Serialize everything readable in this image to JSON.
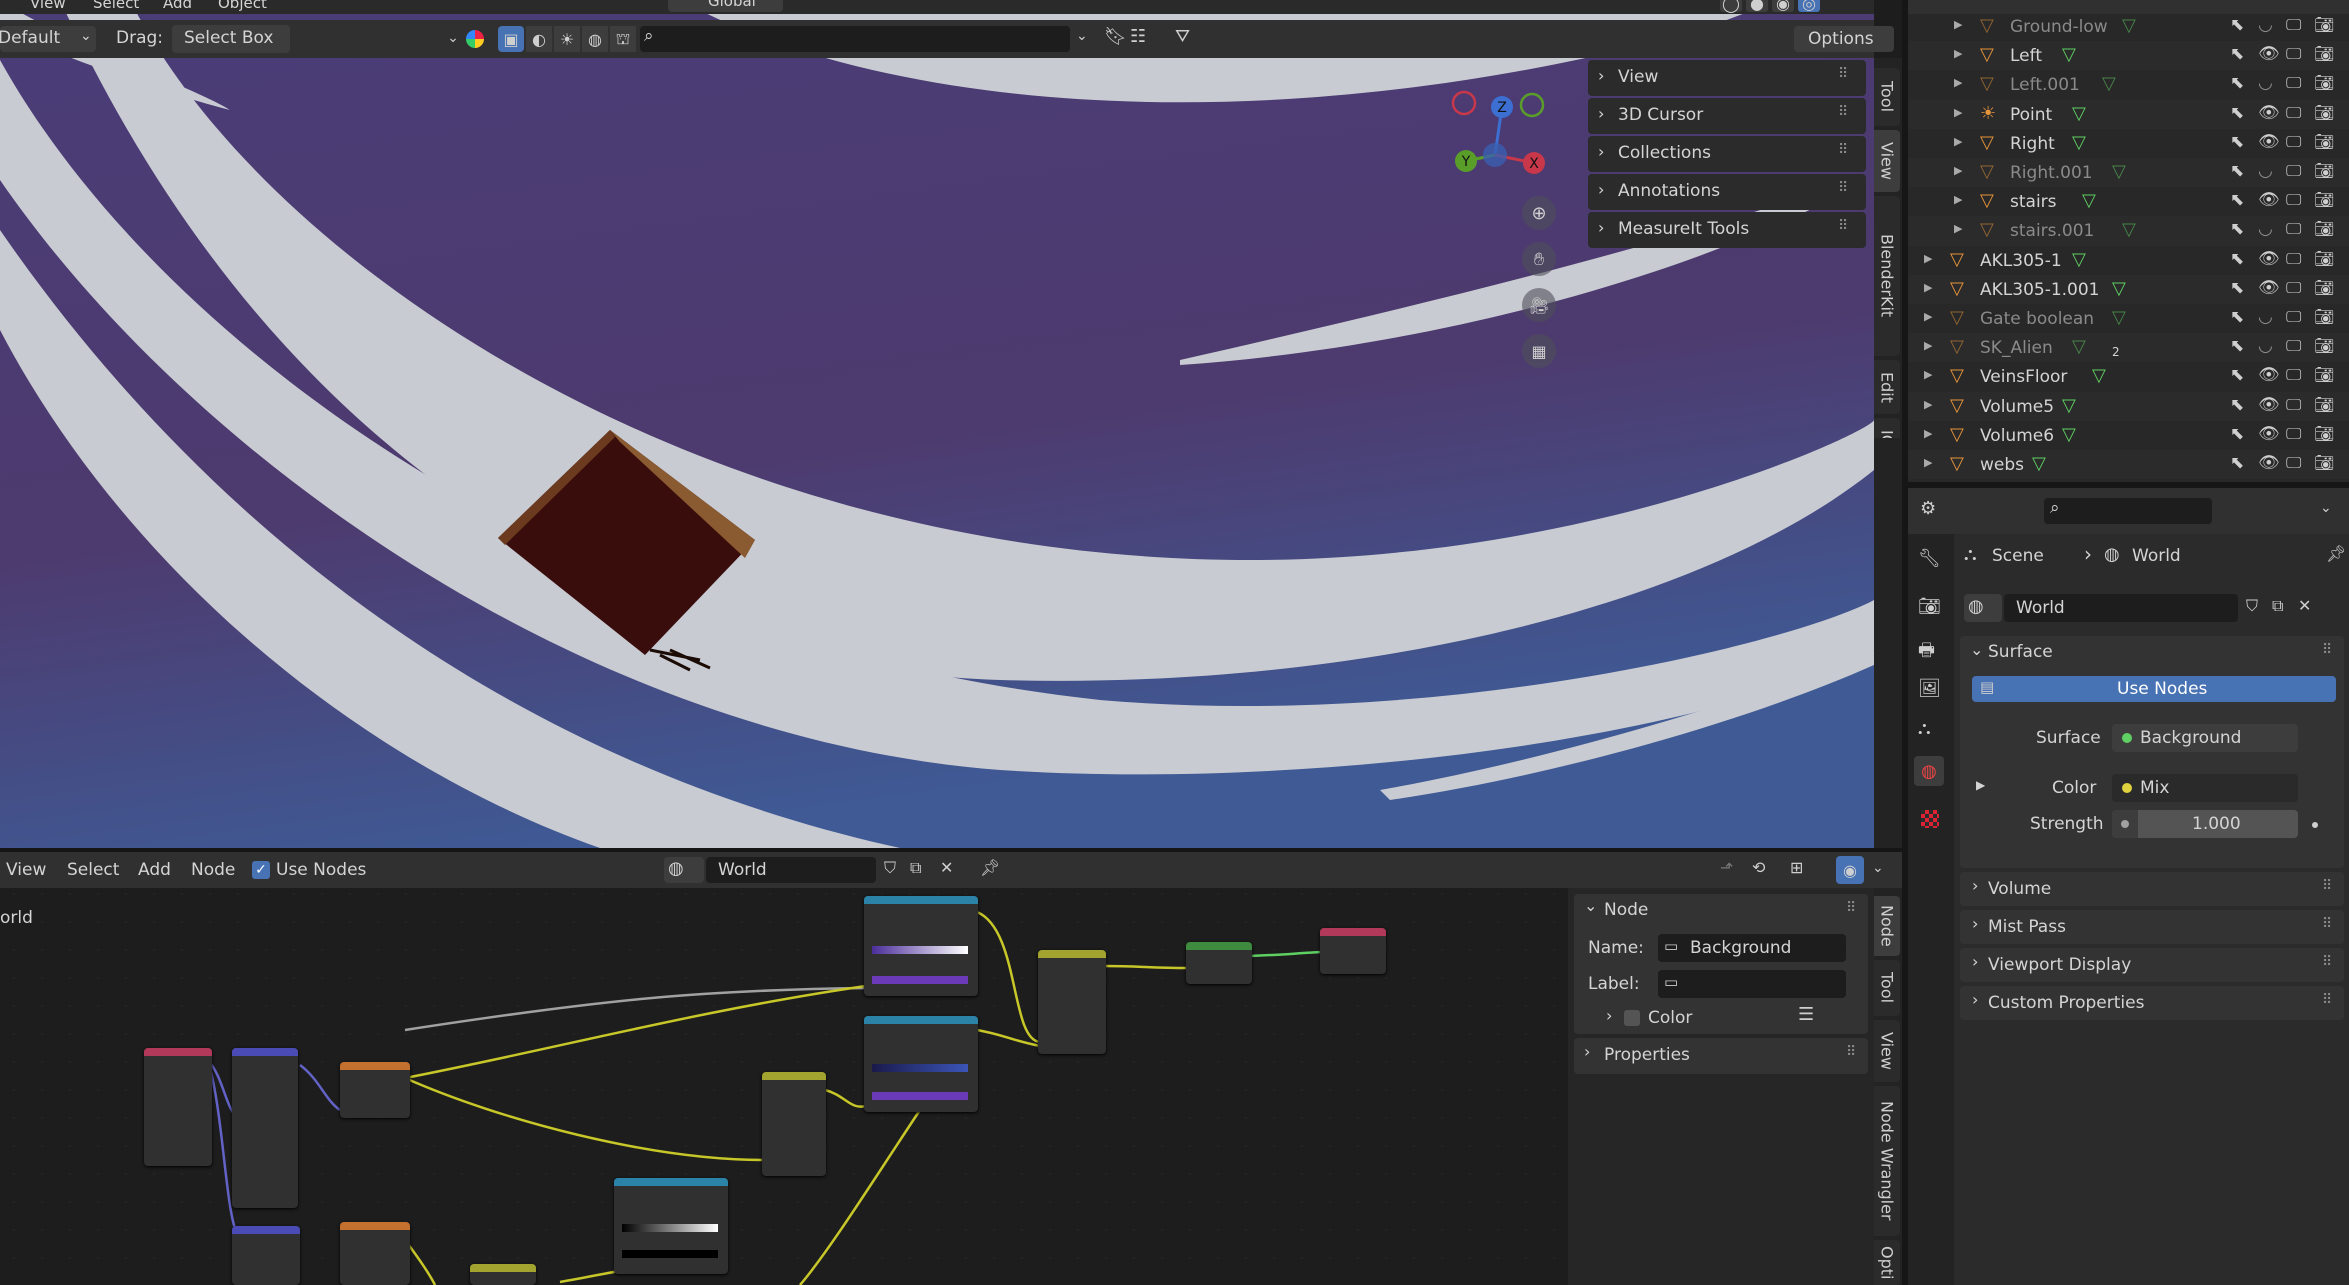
{
  "viewport3d": {
    "header": {
      "mode": "Default",
      "menu": [
        "View",
        "Select",
        "Add",
        "Object"
      ],
      "drag_label": "Drag:",
      "drag_value": "Select Box",
      "transform": "Global",
      "options": "Options"
    },
    "sidebar_panels": [
      "View",
      "3D Cursor",
      "Collections",
      "Annotations",
      "MeasureIt Tools"
    ],
    "sidebar_tabs": [
      "Tool",
      "View",
      "BlenderKit",
      "Edit",
      "ICity"
    ],
    "gizmo": {
      "z": "Z",
      "y": "Y",
      "x": "X"
    }
  },
  "outliner": {
    "nested": [
      {
        "name": "Ground-low",
        "dim": true
      },
      {
        "name": "Left",
        "dim": false
      },
      {
        "name": "Left.001",
        "dim": true
      },
      {
        "name": "Point",
        "dim": false
      },
      {
        "name": "Right",
        "dim": false
      },
      {
        "name": "Right.001",
        "dim": true
      },
      {
        "name": "stairs",
        "dim": false
      },
      {
        "name": "stairs.001",
        "dim": true
      }
    ],
    "top": [
      {
        "name": "AKL305-1",
        "dim": false
      },
      {
        "name": "AKL305-1.001",
        "dim": false
      },
      {
        "name": "Gate boolean",
        "dim": true
      },
      {
        "name": "SK_Alien",
        "dim": true,
        "badge": "2"
      },
      {
        "name": "VeinsFloor",
        "dim": false
      },
      {
        "name": "Volume5",
        "dim": false
      },
      {
        "name": "Volume6",
        "dim": false
      },
      {
        "name": "webs",
        "dim": false
      }
    ]
  },
  "properties": {
    "breadcrumb": {
      "scene": "Scene",
      "world": "World"
    },
    "datablock": "World",
    "surface_panel": "Surface",
    "use_nodes": "Use Nodes",
    "surface_label": "Surface",
    "surface_value": "Background",
    "color_label": "Color",
    "color_value": "Mix",
    "strength_label": "Strength",
    "strength_value": "1.000",
    "collapsed_panels": [
      "Volume",
      "Mist Pass",
      "Viewport Display",
      "Custom Properties"
    ]
  },
  "node_editor": {
    "menu": [
      "View",
      "Select",
      "Add",
      "Node"
    ],
    "use_nodes": "Use Nodes",
    "datablock": "World",
    "world_label": "orld",
    "sidebar": {
      "panel": "Node",
      "name_label": "Name:",
      "name_value": "Background",
      "label_label": "Label:",
      "label_value": "",
      "color_label": "Color",
      "properties": "Properties"
    },
    "tabs": [
      "Node",
      "Tool",
      "View",
      "Node Wrangler",
      "Opti"
    ]
  },
  "colors": {
    "accent_blue": "#4772b3",
    "viewport_purple": "#4b3a72",
    "band_white": "#c9cbd2",
    "mesh_orange": "#e8953a",
    "vertex_green": "#5fcf63"
  }
}
